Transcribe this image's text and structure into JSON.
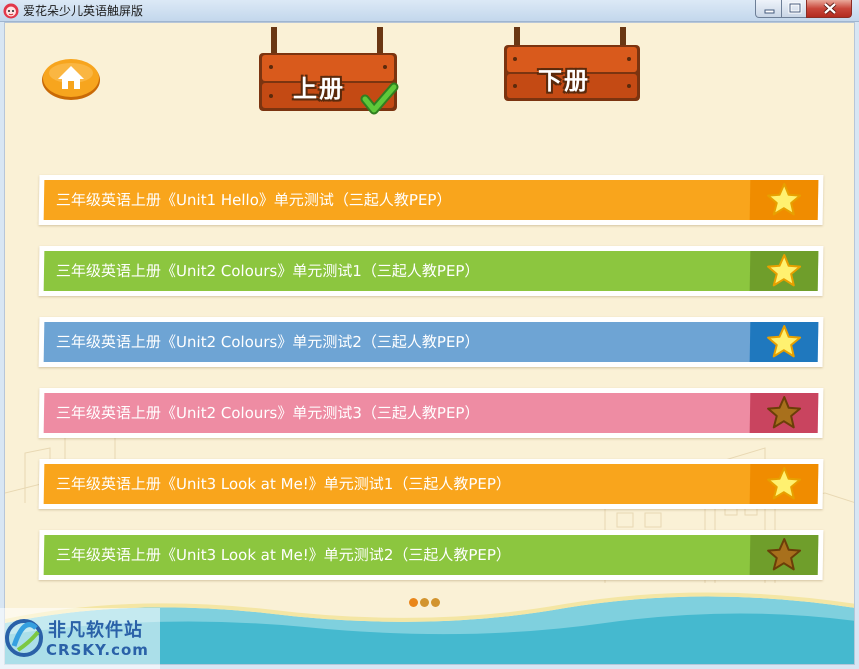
{
  "window": {
    "title": "爱花朵少儿英语触屏版",
    "controls": [
      "minimize",
      "maximize",
      "close"
    ]
  },
  "header": {
    "home_icon": "home-icon",
    "tabs": [
      {
        "label": "上册",
        "selected": true,
        "check_icon": "checkmark-icon"
      },
      {
        "label": "下册",
        "selected": false
      }
    ]
  },
  "lessons": [
    {
      "label": "三年级英语上册《Unit1 Hello》单元测试（三起人教PEP）",
      "color": "#f9a51c",
      "accent": "#f08c00",
      "star": "bright"
    },
    {
      "label": "三年级英语上册《Unit2 Colours》单元测试1（三起人教PEP）",
      "color": "#8cc63f",
      "accent": "#6f9e2b",
      "star": "bright"
    },
    {
      "label": "三年级英语上册《Unit2 Colours》单元测试2（三起人教PEP）",
      "color": "#6ea4d4",
      "accent": "#1f78be",
      "star": "bright"
    },
    {
      "label": "三年级英语上册《Unit2 Colours》单元测试3（三起人教PEP）",
      "color": "#ee8ca3",
      "accent": "#c9445f",
      "star": "dim"
    },
    {
      "label": "三年级英语上册《Unit3 Look at Me!》单元测试1（三起人教PEP）",
      "color": "#f9a51c",
      "accent": "#f08c00",
      "star": "bright"
    },
    {
      "label": "三年级英语上册《Unit3 Look at Me!》单元测试2（三起人教PEP）",
      "color": "#8cc63f",
      "accent": "#6f9e2b",
      "star": "dim"
    }
  ],
  "pager": {
    "pages": 3,
    "current": 1,
    "active_color": "#e9861a",
    "inactive_color": "#d2942e"
  },
  "watermark": {
    "line1": "非凡软件站",
    "line2": "CRSKY.com"
  }
}
